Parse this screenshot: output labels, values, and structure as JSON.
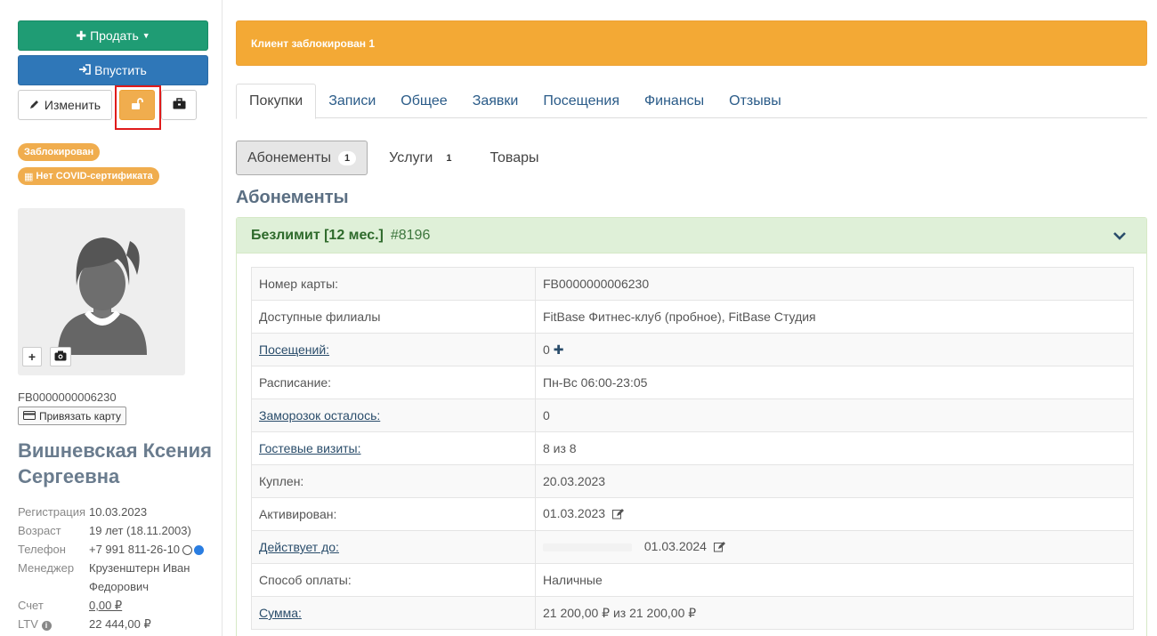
{
  "sidebar": {
    "sell_label": "Продать",
    "enter_label": "Впустить",
    "edit_label": "Изменить",
    "badges": {
      "blocked": "Заблокирован",
      "covid": "Нет COVID-сертификата"
    },
    "card_number": "FB0000000006230",
    "bind_card_label": "Привязать карту",
    "client_name": "Вишневская Ксения Сергеевна",
    "info": {
      "registration_label": "Регистрация",
      "registration_value": "10.03.2023",
      "age_label": "Возраст",
      "age_value": "19 лет (18.11.2003)",
      "phone_label": "Телефон",
      "phone_value": "+7 991 811-26-10",
      "manager_label": "Менеджер",
      "manager_value": "Крузенштерн Иван Федорович",
      "account_label": "Счет",
      "account_value": "0,00 ₽",
      "ltv_label": "LTV",
      "ltv_value": "22 444,00 ₽"
    }
  },
  "alert": {
    "text": "Клиент заблокирован 1"
  },
  "tabs": [
    {
      "label": "Покупки",
      "active": true
    },
    {
      "label": "Записи"
    },
    {
      "label": "Общее"
    },
    {
      "label": "Заявки"
    },
    {
      "label": "Посещения"
    },
    {
      "label": "Финансы"
    },
    {
      "label": "Отзывы"
    }
  ],
  "pills": [
    {
      "label": "Абонементы",
      "count": "1",
      "active": true
    },
    {
      "label": "Услуги",
      "count": "1"
    },
    {
      "label": "Товары"
    }
  ],
  "section_title": "Абонементы",
  "subscription": {
    "name": "Безлимит [12 мес.]",
    "id": "#8196",
    "rows": [
      {
        "key": "Номер карты:",
        "value": "FB0000000006230"
      },
      {
        "key": "Доступные филиалы",
        "value": "FitBase Фитнес-клуб (пробное), FitBase Студия"
      },
      {
        "key": "Посещений:",
        "value": "0",
        "linked": true
      },
      {
        "key": "Расписание:",
        "value": "Пн-Вс 06:00-23:05"
      },
      {
        "key": "Заморозок осталось:",
        "value": "0",
        "linked": true
      },
      {
        "key": "Гостевые визиты:",
        "value": "8 из 8",
        "linked": true
      },
      {
        "key": "Куплен:",
        "value": "20.03.2023"
      },
      {
        "key": "Активирован:",
        "value": "01.03.2023"
      },
      {
        "key": "Действует до:",
        "value": "01.03.2024",
        "linked": true
      },
      {
        "key": "Способ оплаты:",
        "value": "Наличные"
      },
      {
        "key": "Сумма:",
        "value": "21 200,00 ₽ из 21 200,00 ₽",
        "linked": true
      }
    ]
  },
  "colors": {
    "sell": "#1f9c74",
    "enter": "#2f77b8",
    "warning": "#f0ad4e",
    "alert_bg": "#f3a935",
    "panel_head": "#dff0d8"
  }
}
